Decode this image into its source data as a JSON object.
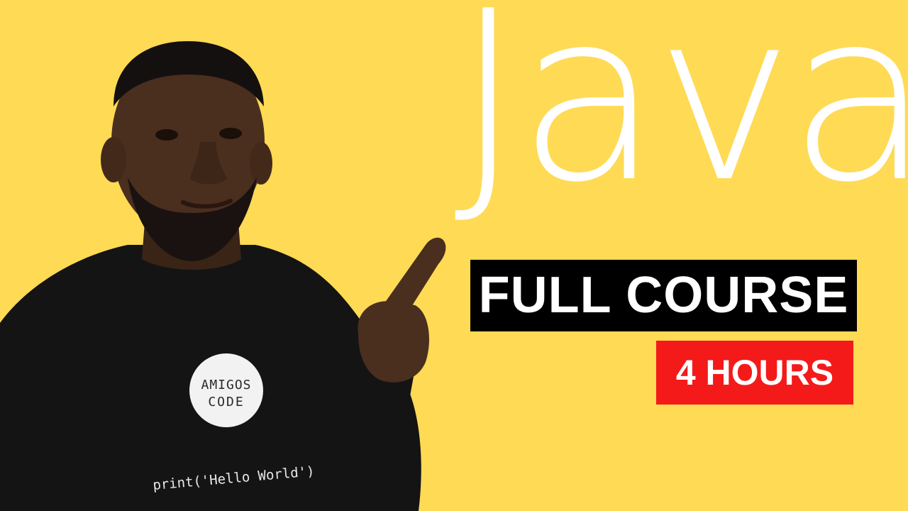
{
  "thumbnail": {
    "title": "Java",
    "badge_course": "FULL COURSE",
    "badge_hours": "4 HOURS",
    "shirt_logo_line1": "AMIGOS",
    "shirt_logo_line2": "CODE",
    "shirt_print": "print('Hello World')",
    "colors": {
      "background": "#FFDA55",
      "title": "#FFFFFF",
      "course_badge_bg": "#000000",
      "hours_badge_bg": "#F41A1A"
    }
  }
}
